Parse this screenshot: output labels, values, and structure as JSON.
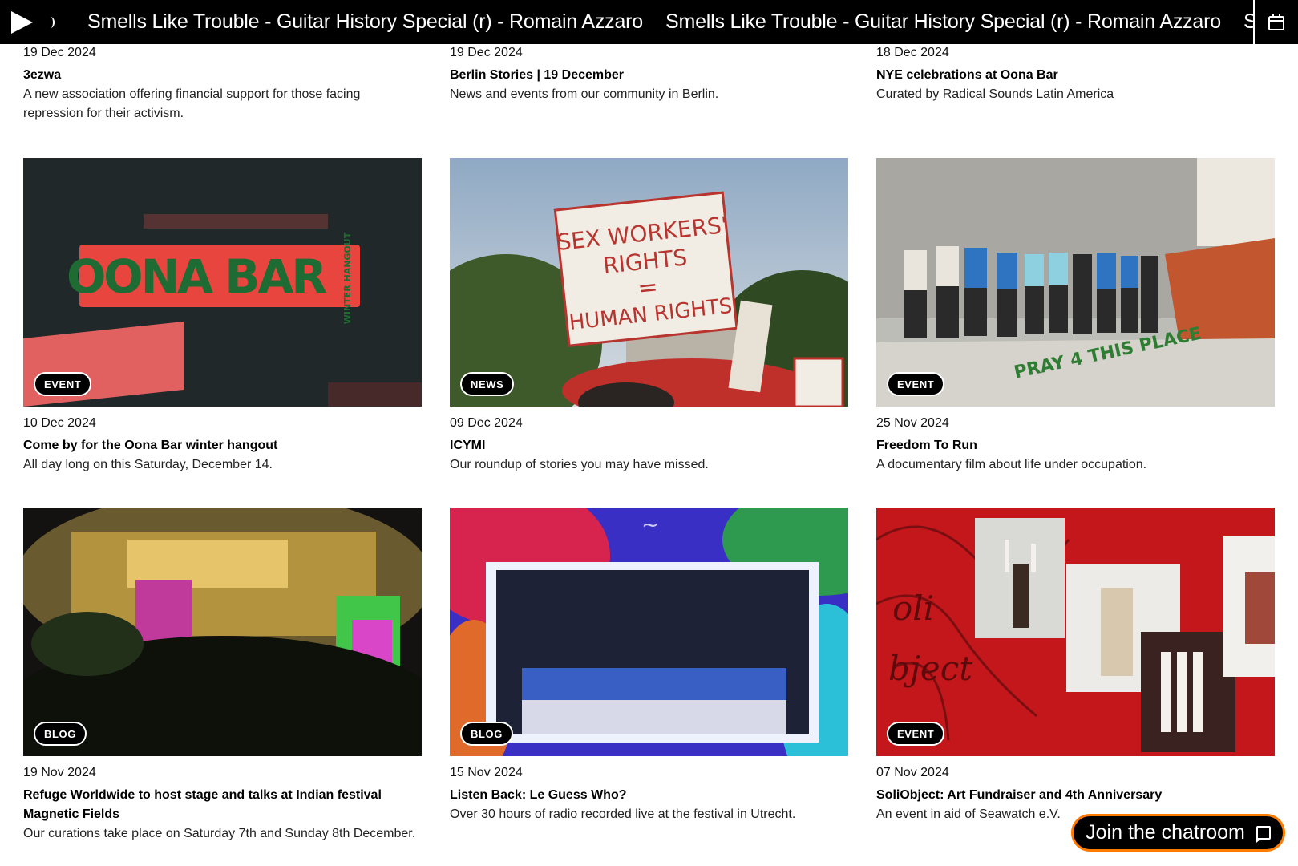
{
  "player": {
    "ticker_items": [
      "Smells Like Trouble - Guitar History Special (r) - Romain Azzaro",
      "Smells Like Trouble - Guitar History Special (r) - Romain Azzaro",
      "Sm"
    ]
  },
  "top_row": [
    {
      "date": "19 Dec 2024",
      "title": "3ezwa",
      "desc": "A new association offering financial support for those facing repression for their activism."
    },
    {
      "date": "19 Dec 2024",
      "title": "Berlin Stories | 19 December",
      "desc": "News and events from our community in Berlin."
    },
    {
      "date": "18 Dec 2024",
      "title": "NYE celebrations at Oona Bar",
      "desc": "Curated by Radical Sounds Latin America"
    }
  ],
  "row2": [
    {
      "tag": "EVENT",
      "date": "10 Dec 2024",
      "title": "Come by for the Oona Bar winter hangout",
      "desc": "All day long on this Saturday, December 14."
    },
    {
      "tag": "NEWS",
      "date": "09 Dec 2024",
      "title": "ICYMI",
      "desc": "Our roundup of stories you may have missed."
    },
    {
      "tag": "EVENT",
      "date": "25 Nov 2024",
      "title": "Freedom To Run",
      "desc": "A documentary film about life under occupation."
    }
  ],
  "row3": [
    {
      "tag": "BLOG",
      "date": "19 Nov 2024",
      "title": "Refuge Worldwide to host stage and talks at Indian festival Magnetic Fields",
      "desc": "Our curations take place on Saturday 7th and Sunday 8th December."
    },
    {
      "tag": "BLOG",
      "date": "15 Nov 2024",
      "title": "Listen Back: Le Guess Who?",
      "desc": "Over 30 hours of radio recorded live at the festival in Utrecht."
    },
    {
      "tag": "EVENT",
      "date": "07 Nov 2024",
      "title": "SoliObject: Art Fundraiser and 4th Anniversary",
      "desc": "An event in aid of Seawatch e.V."
    }
  ],
  "images": {
    "oona_logo": "OONA BAR",
    "oona_side": "WINTER HANGOUT",
    "sign_text_1": "SEX WORKERS'",
    "sign_text_2": "RIGHTS",
    "sign_text_3": "=",
    "sign_text_4": "HUMAN RIGHTS",
    "wall_text": "PRAY 4 THIS PLACE",
    "soli_text_1": "oli",
    "soli_text_2": "bject"
  },
  "chat": {
    "label": "Join the chatroom"
  },
  "colors": {
    "accent_orange": "#ff7a00",
    "oona_red": "#e8453f",
    "oona_green": "#1e6b33",
    "soli_red": "#c4171b"
  }
}
